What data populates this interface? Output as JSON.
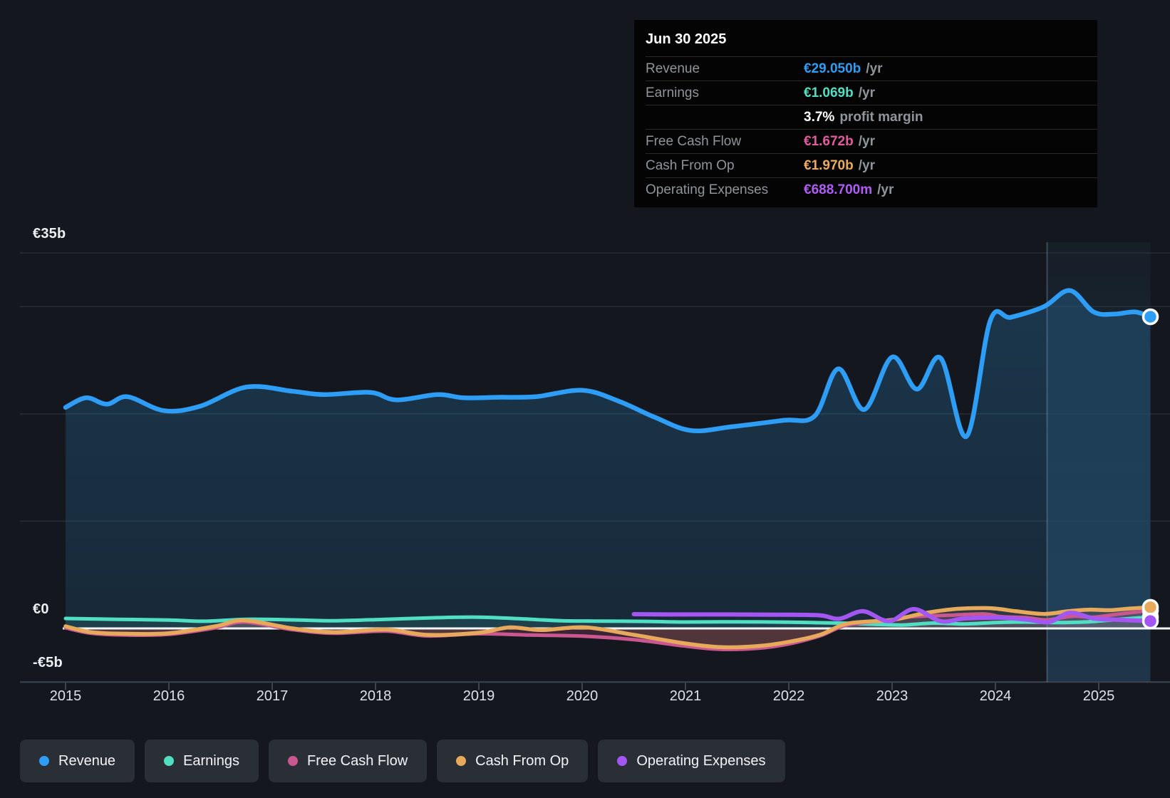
{
  "tooltip": {
    "date": "Jun 30 2025",
    "rows": [
      {
        "label": "Revenue",
        "value": "€29.050b",
        "suffix": "/yr",
        "color": "#2E9DF5"
      },
      {
        "label": "Earnings",
        "value": "€1.069b",
        "suffix": "/yr",
        "color": "#50DFC3"
      },
      {
        "label": "",
        "value": "3.7%",
        "suffix": "profit margin",
        "color": "#FFFFFF"
      },
      {
        "label": "Free Cash Flow",
        "value": "€1.672b",
        "suffix": "/yr",
        "color": "#E35A9F"
      },
      {
        "label": "Cash From Op",
        "value": "€1.970b",
        "suffix": "/yr",
        "color": "#EBAB5E"
      },
      {
        "label": "Operating Expenses",
        "value": "€688.700m",
        "suffix": "/yr",
        "color": "#B15CF6"
      }
    ]
  },
  "legend": {
    "items": [
      {
        "id": "revenue",
        "label": "Revenue",
        "color": "#2E9DF5"
      },
      {
        "id": "earnings",
        "label": "Earnings",
        "color": "#50DFC3"
      },
      {
        "id": "fcf",
        "label": "Free Cash Flow",
        "color": "#CB5790"
      },
      {
        "id": "cashop",
        "label": "Cash From Op",
        "color": "#E7A95C"
      },
      {
        "id": "opex",
        "label": "Operating Expenses",
        "color": "#A356F2"
      }
    ]
  },
  "chart_data": {
    "type": "line",
    "title": "Financial history: revenue, earnings and cash flow (€ billions)",
    "x_axis": {
      "tick_labels": [
        "2015",
        "2016",
        "2017",
        "2018",
        "2019",
        "2020",
        "2021",
        "2022",
        "2023",
        "2024",
        "2025"
      ],
      "min": 2015,
      "max": 2025.5
    },
    "y_axis": {
      "unit": "€b",
      "min": -5,
      "max": 35,
      "gridline_values": [
        35,
        30,
        20,
        10
      ],
      "label_ticks": [
        {
          "label": "€35b",
          "value": 35
        },
        {
          "label": "€0",
          "value": 0
        },
        {
          "label": "-€5b",
          "value": -5
        }
      ]
    },
    "highlight_band": {
      "from": 2024.5,
      "to": 2025.5
    },
    "zero_line_color": "#F3F6F8",
    "gridline_color": "#2B323C",
    "axis_color": "#3E4550",
    "series": [
      {
        "id": "earnings",
        "name": "Earnings",
        "color": "#50DFC3",
        "width": 5,
        "fill": "rgba(80,220,195,0.14)",
        "end_marker": true,
        "points": [
          [
            2015,
            0.93
          ],
          [
            2015.5,
            0.85
          ],
          [
            2016,
            0.78
          ],
          [
            2016.35,
            0.67
          ],
          [
            2016.75,
            0.85
          ],
          [
            2017.2,
            0.8
          ],
          [
            2017.6,
            0.72
          ],
          [
            2018.1,
            0.85
          ],
          [
            2018.6,
            1.0
          ],
          [
            2019,
            1.05
          ],
          [
            2019.4,
            0.9
          ],
          [
            2019.8,
            0.72
          ],
          [
            2020.2,
            0.68
          ],
          [
            2020.6,
            0.66
          ],
          [
            2021,
            0.6
          ],
          [
            2021.5,
            0.62
          ],
          [
            2022,
            0.58
          ],
          [
            2022.5,
            0.5
          ],
          [
            2022.8,
            0.4
          ],
          [
            2023.1,
            0.32
          ],
          [
            2023.4,
            0.5
          ],
          [
            2023.7,
            0.42
          ],
          [
            2024,
            0.55
          ],
          [
            2024.3,
            0.6
          ],
          [
            2024.6,
            0.55
          ],
          [
            2024.9,
            0.62
          ],
          [
            2025.2,
            0.85
          ],
          [
            2025.5,
            1.069
          ]
        ]
      },
      {
        "id": "fcf",
        "name": "Free Cash Flow",
        "color": "#CB5790",
        "width": 5,
        "fill": "rgba(200,80,140,0.22)",
        "end_marker": true,
        "points": [
          [
            2015,
            0.05
          ],
          [
            2015.25,
            -0.45
          ],
          [
            2015.6,
            -0.62
          ],
          [
            2016,
            -0.55
          ],
          [
            2016.45,
            0.05
          ],
          [
            2016.73,
            0.6
          ],
          [
            2017.2,
            -0.12
          ],
          [
            2017.6,
            -0.45
          ],
          [
            2018.1,
            -0.25
          ],
          [
            2018.5,
            -0.7
          ],
          [
            2019,
            -0.5
          ],
          [
            2019.5,
            -0.62
          ],
          [
            2020,
            -0.72
          ],
          [
            2020.5,
            -1.05
          ],
          [
            2021,
            -1.65
          ],
          [
            2021.35,
            -1.95
          ],
          [
            2021.7,
            -1.85
          ],
          [
            2022,
            -1.45
          ],
          [
            2022.3,
            -0.7
          ],
          [
            2022.57,
            0.33
          ],
          [
            2023,
            0.8
          ],
          [
            2023.2,
            1.1
          ],
          [
            2023.6,
            1.25
          ],
          [
            2023.9,
            1.35
          ],
          [
            2024.05,
            1.1
          ],
          [
            2024.3,
            1.0
          ],
          [
            2024.5,
            0.8
          ],
          [
            2024.75,
            1.15
          ],
          [
            2024.95,
            1.05
          ],
          [
            2025.2,
            1.35
          ],
          [
            2025.5,
            1.672
          ]
        ]
      },
      {
        "id": "cashop",
        "name": "Cash From Op",
        "color": "#E7A95C",
        "width": 5.5,
        "fill": "rgba(230,170,95,0.13)",
        "end_marker": true,
        "points": [
          [
            2015,
            0.2
          ],
          [
            2015.25,
            -0.35
          ],
          [
            2015.6,
            -0.5
          ],
          [
            2016,
            -0.45
          ],
          [
            2016.45,
            0.2
          ],
          [
            2016.73,
            0.75
          ],
          [
            2017.2,
            0.0
          ],
          [
            2017.6,
            -0.35
          ],
          [
            2018.1,
            -0.1
          ],
          [
            2018.5,
            -0.6
          ],
          [
            2019,
            -0.4
          ],
          [
            2019.3,
            0.1
          ],
          [
            2019.6,
            -0.15
          ],
          [
            2020.03,
            0.1
          ],
          [
            2020.5,
            -0.6
          ],
          [
            2021,
            -1.4
          ],
          [
            2021.35,
            -1.75
          ],
          [
            2021.7,
            -1.65
          ],
          [
            2022,
            -1.25
          ],
          [
            2022.3,
            -0.6
          ],
          [
            2022.57,
            0.45
          ],
          [
            2023,
            0.8
          ],
          [
            2023.3,
            1.4
          ],
          [
            2023.6,
            1.8
          ],
          [
            2023.9,
            1.9
          ],
          [
            2024.05,
            1.8
          ],
          [
            2024.2,
            1.6
          ],
          [
            2024.47,
            1.35
          ],
          [
            2024.7,
            1.6
          ],
          [
            2024.9,
            1.75
          ],
          [
            2025.1,
            1.7
          ],
          [
            2025.3,
            1.85
          ],
          [
            2025.5,
            1.97
          ]
        ]
      },
      {
        "id": "opex",
        "name": "Operating Expenses",
        "color": "#A356F2",
        "width": 6,
        "fill": null,
        "end_marker": true,
        "points": [
          [
            2020.5,
            1.33
          ],
          [
            2020.9,
            1.3
          ],
          [
            2021.4,
            1.3
          ],
          [
            2021.9,
            1.28
          ],
          [
            2022.3,
            1.22
          ],
          [
            2022.49,
            0.9
          ],
          [
            2022.72,
            1.6
          ],
          [
            2022.97,
            0.67
          ],
          [
            2023.21,
            1.8
          ],
          [
            2023.47,
            0.67
          ],
          [
            2023.7,
            0.93
          ],
          [
            2024.03,
            1.0
          ],
          [
            2024.3,
            0.82
          ],
          [
            2024.52,
            0.6
          ],
          [
            2024.72,
            1.46
          ],
          [
            2024.95,
            0.93
          ],
          [
            2025.2,
            0.8
          ],
          [
            2025.5,
            0.689
          ]
        ]
      },
      {
        "id": "revenue",
        "name": "Revenue",
        "color": "#2E9DF5",
        "width": 6.5,
        "fill": "gradient",
        "end_marker": true,
        "points": [
          [
            2015,
            20.6
          ],
          [
            2015.2,
            21.5
          ],
          [
            2015.4,
            20.9
          ],
          [
            2015.6,
            21.6
          ],
          [
            2015.95,
            20.3
          ],
          [
            2016.3,
            20.7
          ],
          [
            2016.75,
            22.5
          ],
          [
            2017.2,
            22.1
          ],
          [
            2017.5,
            21.8
          ],
          [
            2017.95,
            22.0
          ],
          [
            2018.2,
            21.3
          ],
          [
            2018.6,
            21.8
          ],
          [
            2018.85,
            21.5
          ],
          [
            2019.2,
            21.55
          ],
          [
            2019.55,
            21.6
          ],
          [
            2020.0,
            22.2
          ],
          [
            2020.35,
            21.2
          ],
          [
            2020.7,
            19.7
          ],
          [
            2021.05,
            18.45
          ],
          [
            2021.45,
            18.8
          ],
          [
            2021.95,
            19.4
          ],
          [
            2022.25,
            19.8
          ],
          [
            2022.48,
            24.2
          ],
          [
            2022.73,
            20.4
          ],
          [
            2023.0,
            25.3
          ],
          [
            2023.24,
            22.3
          ],
          [
            2023.47,
            25.2
          ],
          [
            2023.72,
            17.9
          ],
          [
            2023.95,
            28.7
          ],
          [
            2024.15,
            29.0
          ],
          [
            2024.47,
            30.0
          ],
          [
            2024.72,
            31.5
          ],
          [
            2024.95,
            29.5
          ],
          [
            2025.15,
            29.3
          ],
          [
            2025.35,
            29.5
          ],
          [
            2025.5,
            29.05
          ]
        ]
      }
    ]
  }
}
